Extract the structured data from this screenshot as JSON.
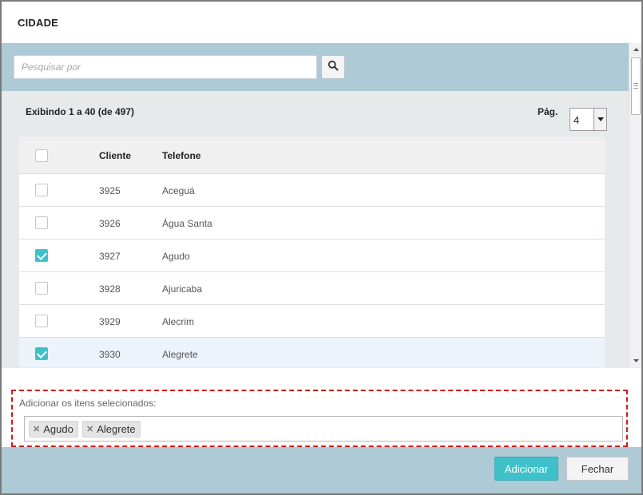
{
  "dialog": {
    "title": "CIDADE"
  },
  "search": {
    "placeholder": "Pesquisar por",
    "value": "",
    "button_icon": "search-icon"
  },
  "results": {
    "info": "Exibindo 1 a 40 (de 497)",
    "page_label": "Pág.",
    "page_value": "4"
  },
  "table": {
    "headers": {
      "client": "Cliente",
      "phone": "Telefone"
    },
    "rows": [
      {
        "id": "3925",
        "name": "Aceguá",
        "checked": false
      },
      {
        "id": "3926",
        "name": "Água Santa",
        "checked": false
      },
      {
        "id": "3927",
        "name": "Agudo",
        "checked": true
      },
      {
        "id": "3928",
        "name": "Ajuricaba",
        "checked": false
      },
      {
        "id": "3929",
        "name": "Alecrim",
        "checked": false
      },
      {
        "id": "3930",
        "name": "Alegrete",
        "checked": true
      }
    ]
  },
  "selected": {
    "label": "Adicionar os itens selecionados:",
    "tags": [
      {
        "label": "Agudo"
      },
      {
        "label": "Alegrete"
      }
    ]
  },
  "footer": {
    "add_label": "Adicionar",
    "close_label": "Fechar"
  },
  "colors": {
    "accent": "#3fc1c9",
    "band": "#aecad6",
    "highlight_border": "#d11a1a"
  }
}
